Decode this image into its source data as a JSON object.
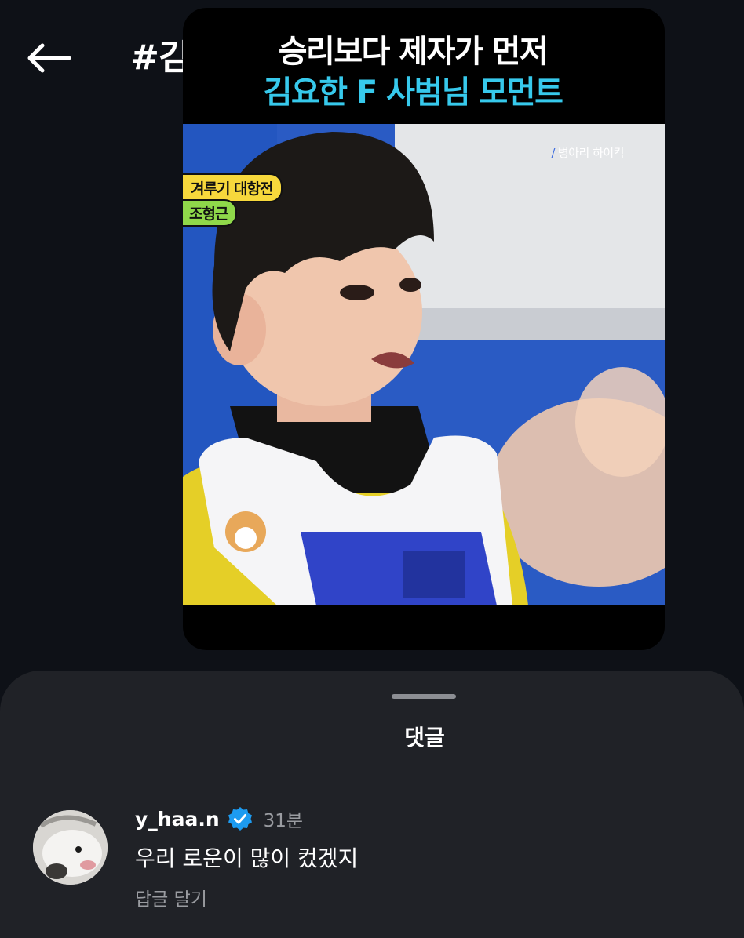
{
  "header": {
    "back_icon": "arrow-left-icon",
    "hashtag": "#김요한"
  },
  "video": {
    "caption_line1": "승리보다 제자가 먼저",
    "caption_line2": "김요한 F 사범님 모먼트",
    "caption_line2_color": "#37c9ec",
    "frame_credit": "병아리 하이킥",
    "frame_banner1": "겨루기 대항전",
    "frame_banner2": "조형근"
  },
  "comments_sheet": {
    "title": "댓글",
    "comments": [
      {
        "username": "y_haa.n",
        "verified_icon": "verified-badge-icon",
        "time": "31분",
        "text": "우리 로운이 많이 컸겠지",
        "reply_label": "답글 달기"
      }
    ]
  },
  "colors": {
    "background": "#0e1117",
    "sheet": "#202227",
    "verified": "#1d9bf0",
    "muted_text": "#9a9ca1"
  }
}
